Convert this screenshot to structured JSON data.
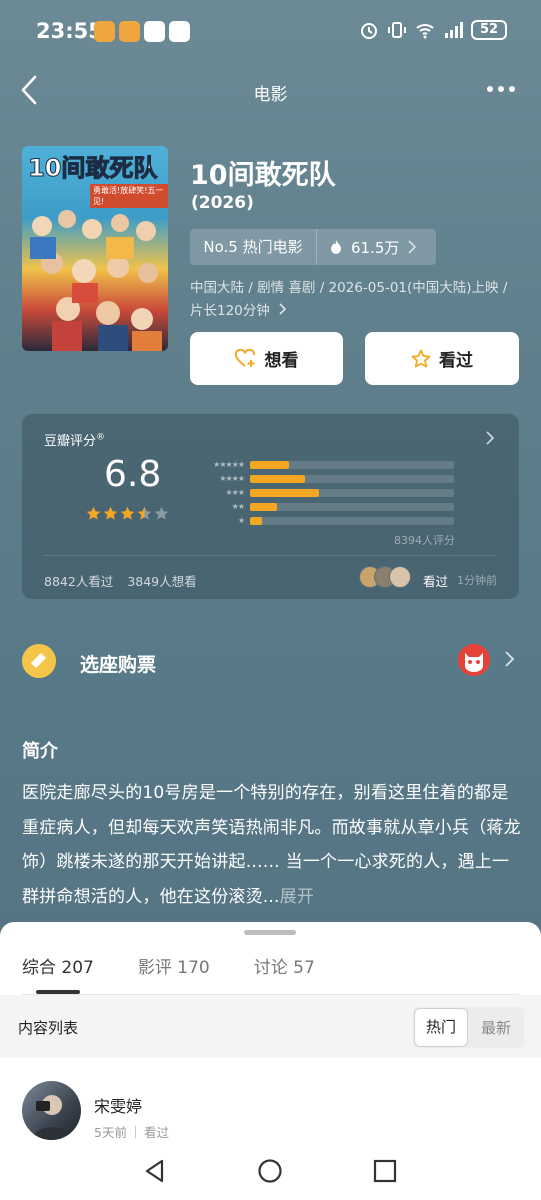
{
  "status_bar": {
    "time": "23:55",
    "battery": "52"
  },
  "nav": {
    "title": "电影"
  },
  "movie": {
    "poster_title": "10间敢死队",
    "poster_tagline": "勇敢活!放肆笑!五一见!",
    "title": "10间敢死队",
    "year": "(2026)",
    "rank": "No.5 热门电影",
    "heat": "61.5万",
    "meta": "中国大陆 / 剧情 喜剧 / 2026-05-01(中国大陆)上映 / 片长120分钟"
  },
  "actions": {
    "want": "想看",
    "seen": "看过"
  },
  "rating": {
    "label": "豆瓣评分",
    "registered_mark": "®",
    "score": "6.8",
    "stars_filled": 3.5,
    "star_rows": [
      "★★★★★",
      "★★★★",
      "★★★",
      "★★",
      "★"
    ],
    "distribution": [
      0.19,
      0.27,
      0.34,
      0.13,
      0.06
    ],
    "rating_count": "8394人评分",
    "seen_count": "8842人看过",
    "want_count": "3849人想看",
    "friend_action": "看过",
    "friend_time": "1分钟前",
    "star_color": "#f5a623"
  },
  "tickets": {
    "label": "选座购票"
  },
  "intro": {
    "heading": "简介",
    "text": "医院走廊尽头的10号房是一个特别的存在，别看这里住着的都是重症病人，但却每天欢声笑语热闹非凡。而故事就从章小兵（蒋龙 饰）跳楼未遂的那天开始讲起…… 当一个一心求死的人，遇上一群拼命想活的人，他在这份滚烫...",
    "more": "展开"
  },
  "sheet": {
    "tabs": [
      {
        "label": "综合 207"
      },
      {
        "label": "影评 170"
      },
      {
        "label": "讨论 57"
      }
    ],
    "list_label": "内容列表",
    "sort_hot": "热门",
    "sort_new": "最新"
  },
  "post": {
    "user": "宋雯婷",
    "time": "5天前",
    "action": "看过"
  }
}
